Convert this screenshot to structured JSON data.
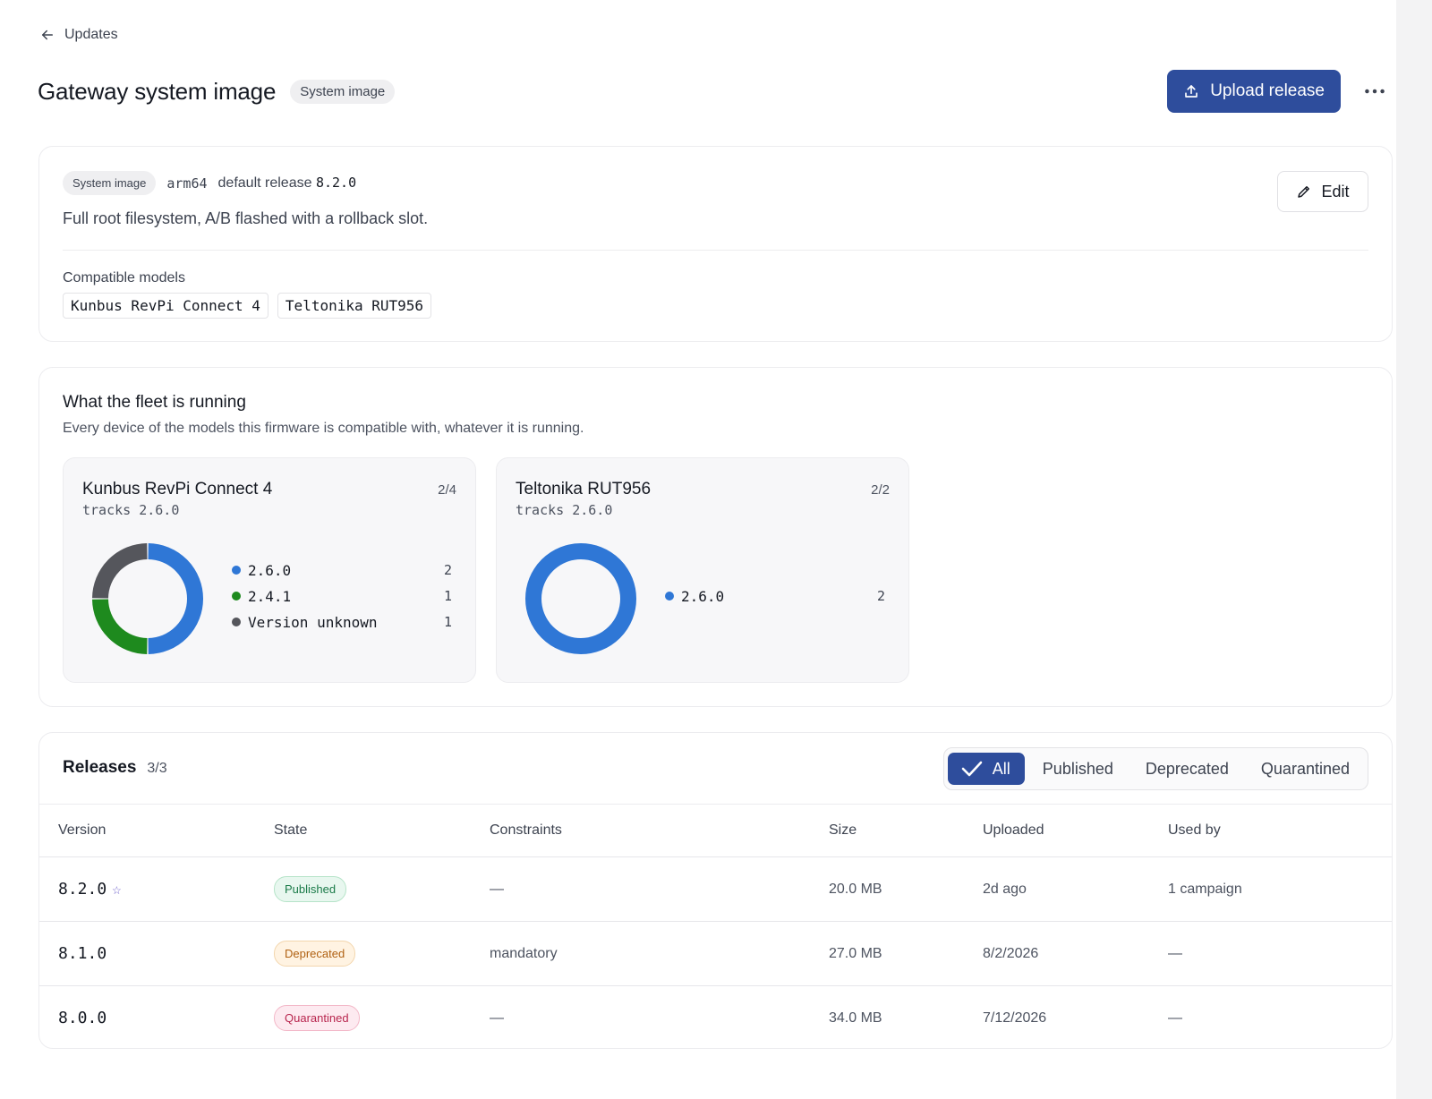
{
  "nav": {
    "back_label": "Updates"
  },
  "header": {
    "title": "Gateway system image",
    "badge": "System image",
    "upload_label": "Upload release"
  },
  "info": {
    "type_badge": "System image",
    "arch": "arm64",
    "default_label": "default release",
    "default_version": "8.2.0",
    "description": "Full root filesystem, A/B flashed with a rollback slot.",
    "edit_label": "Edit",
    "compatible_label": "Compatible models",
    "compatible_models": [
      "Kunbus RevPi Connect 4",
      "Teltonika RUT956"
    ]
  },
  "fleet": {
    "title": "What the fleet is running",
    "subtitle": "Every device of the models this firmware is compatible with, whatever it is running.",
    "models": [
      {
        "name": "Kunbus RevPi Connect 4",
        "tracks": "tracks 2.6.0",
        "count": "2/4",
        "versions": [
          {
            "label": "2.6.0",
            "value": 2,
            "color": "#2f77d6"
          },
          {
            "label": "2.4.1",
            "value": 1,
            "color": "#1e8a1e"
          },
          {
            "label": "Version unknown",
            "value": 1,
            "color": "#55565c"
          }
        ]
      },
      {
        "name": "Teltonika RUT956",
        "tracks": "tracks 2.6.0",
        "count": "2/2",
        "versions": [
          {
            "label": "2.6.0",
            "value": 2,
            "color": "#2f77d6"
          }
        ]
      }
    ]
  },
  "releases": {
    "title": "Releases",
    "count": "3/3",
    "filters": [
      {
        "label": "All",
        "active": true
      },
      {
        "label": "Published",
        "active": false
      },
      {
        "label": "Deprecated",
        "active": false
      },
      {
        "label": "Quarantined",
        "active": false
      }
    ],
    "columns": [
      "Version",
      "State",
      "Constraints",
      "Size",
      "Uploaded",
      "Used by"
    ],
    "rows": [
      {
        "version": "8.2.0",
        "default": true,
        "state": "Published",
        "constraints": "—",
        "size": "20.0 MB",
        "uploaded": "2d ago",
        "used_by": "1 campaign"
      },
      {
        "version": "8.1.0",
        "default": false,
        "state": "Deprecated",
        "constraints": "mandatory",
        "size": "27.0 MB",
        "uploaded": "8/2/2026",
        "used_by": "—"
      },
      {
        "version": "8.0.0",
        "default": false,
        "state": "Quarantined",
        "constraints": "—",
        "size": "34.0 MB",
        "uploaded": "7/12/2026",
        "used_by": "—"
      }
    ]
  },
  "icons": {
    "back": "arrow-left-icon",
    "upload": "upload-icon",
    "more": "more-horizontal-icon",
    "edit": "pencil-icon",
    "check": "check-icon",
    "default_star": "star-icon"
  },
  "colors": {
    "primary": "#2e4d9c",
    "published": "#1a7a48",
    "deprecated": "#b06112",
    "quarantined": "#b8264e"
  }
}
